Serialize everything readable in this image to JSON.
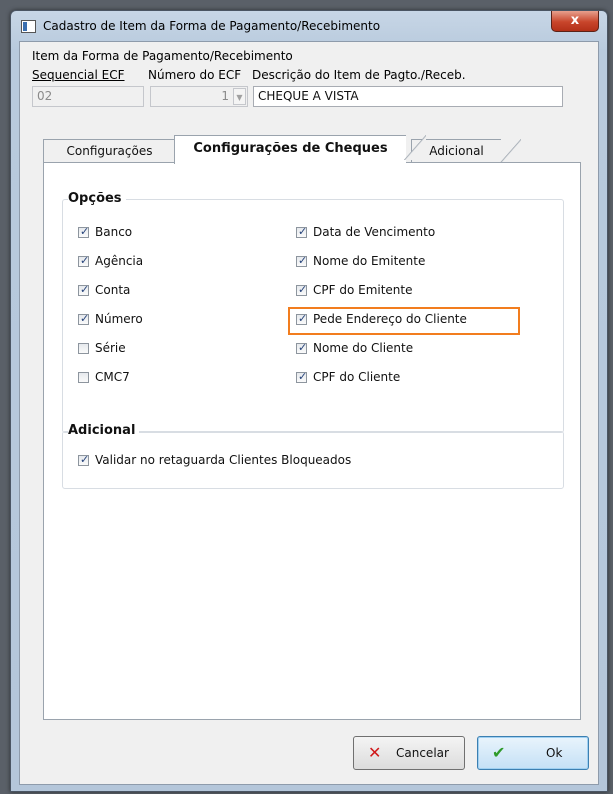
{
  "window": {
    "title": "Cadastro de Item da Forma de Pagamento/Recebimento",
    "close_label": "x"
  },
  "header": {
    "group_label": "Item da Forma de Pagamento/Recebimento",
    "seq_label": "Sequencial ECF",
    "seq_value": "02",
    "num_label": "Número do ECF",
    "num_value": "1",
    "desc_label": "Descrição do Item de Pagto./Receb.",
    "desc_value": "CHEQUE A VISTA"
  },
  "tabs": [
    {
      "label": "Configurações"
    },
    {
      "label": "Configurações de Cheques"
    },
    {
      "label": "Adicional"
    }
  ],
  "opcoes": {
    "title": "Opções",
    "left": [
      {
        "label": "Banco",
        "checked": true
      },
      {
        "label": "Agência",
        "checked": true
      },
      {
        "label": "Conta",
        "checked": true
      },
      {
        "label": "Número",
        "checked": true
      },
      {
        "label": "Série",
        "checked": false
      },
      {
        "label": "CMC7",
        "checked": false
      }
    ],
    "right": [
      {
        "label": "Data de Vencimento",
        "checked": true
      },
      {
        "label": "Nome do Emitente",
        "checked": true
      },
      {
        "label": "CPF do Emitente",
        "checked": true
      },
      {
        "label": "Pede Endereço do Cliente",
        "checked": true
      },
      {
        "label": "Nome do Cliente",
        "checked": true
      },
      {
        "label": "CPF do Cliente",
        "checked": true
      }
    ]
  },
  "adicional": {
    "title": "Adicional",
    "items": [
      {
        "label": "Validar no retaguarda Clientes Bloqueados",
        "checked": true
      }
    ]
  },
  "buttons": {
    "cancel_label": "Cancelar",
    "ok_label": "Ok"
  },
  "colors": {
    "highlight": "#f27d1e",
    "cancel_icon": "#d0181a",
    "ok_icon": "#2e9a2a"
  }
}
